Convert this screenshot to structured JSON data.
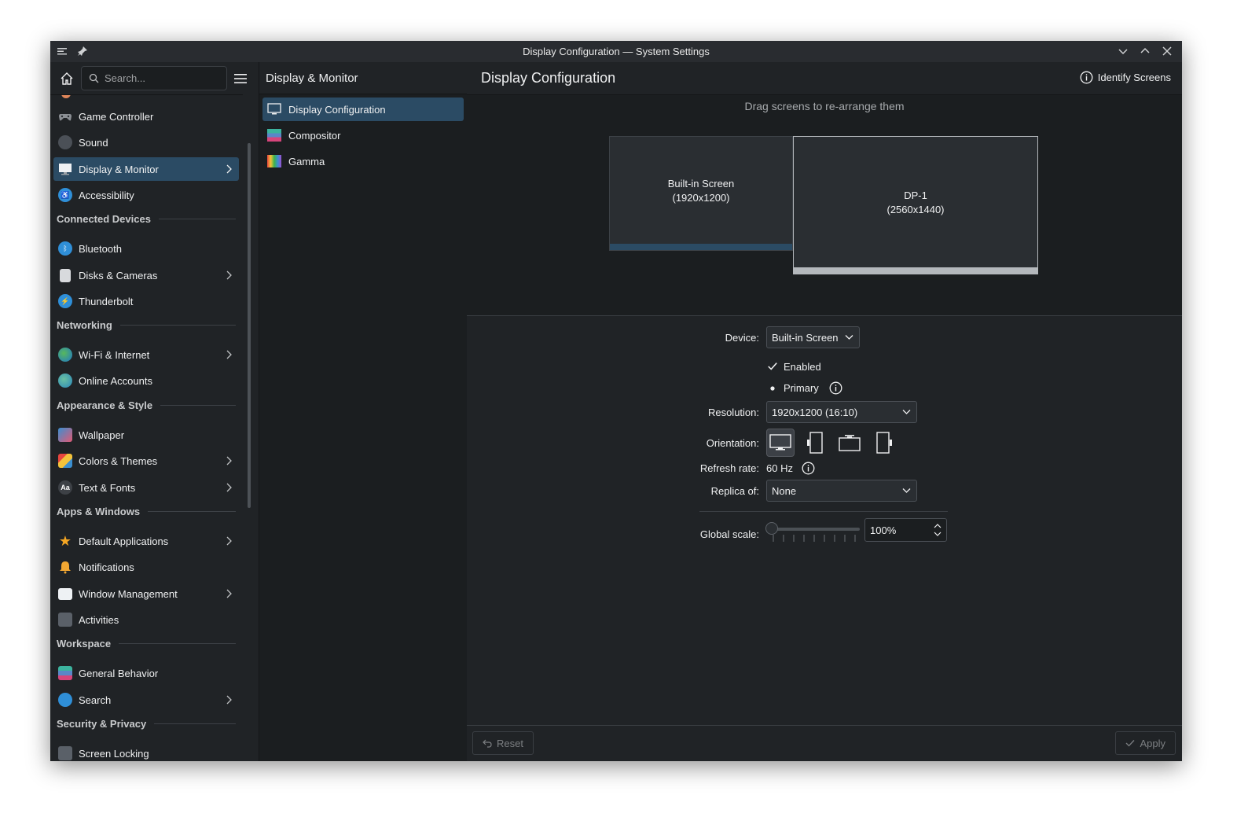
{
  "window": {
    "title": "Display Configuration — System Settings"
  },
  "search": {
    "placeholder": "Search..."
  },
  "sidebar": {
    "items": [
      {
        "label": "Game Controller",
        "icon": "gamepad-icon"
      },
      {
        "label": "Sound",
        "icon": "speaker-icon"
      },
      {
        "label": "Display & Monitor",
        "icon": "monitor-icon",
        "active": true,
        "chevron": true
      },
      {
        "label": "Accessibility",
        "icon": "accessibility-icon"
      }
    ],
    "sections": [
      {
        "title": "Connected Devices",
        "items": [
          {
            "label": "Bluetooth",
            "icon": "bluetooth-icon"
          },
          {
            "label": "Disks & Cameras",
            "icon": "disk-icon",
            "chevron": true
          },
          {
            "label": "Thunderbolt",
            "icon": "thunderbolt-icon"
          }
        ]
      },
      {
        "title": "Networking",
        "items": [
          {
            "label": "Wi-Fi & Internet",
            "icon": "globe-icon",
            "chevron": true
          },
          {
            "label": "Online Accounts",
            "icon": "online-accounts-icon"
          }
        ]
      },
      {
        "title": "Appearance & Style",
        "items": [
          {
            "label": "Wallpaper",
            "icon": "wallpaper-icon"
          },
          {
            "label": "Colors & Themes",
            "icon": "colors-icon",
            "chevron": true
          },
          {
            "label": "Text & Fonts",
            "icon": "fonts-icon",
            "chevron": true
          }
        ]
      },
      {
        "title": "Apps & Windows",
        "items": [
          {
            "label": "Default Applications",
            "icon": "star-icon",
            "chevron": true
          },
          {
            "label": "Notifications",
            "icon": "bell-icon"
          },
          {
            "label": "Window Management",
            "icon": "window-icon",
            "chevron": true
          },
          {
            "label": "Activities",
            "icon": "activities-icon"
          }
        ]
      },
      {
        "title": "Workspace",
        "items": [
          {
            "label": "General Behavior",
            "icon": "general-behavior-icon"
          },
          {
            "label": "Search",
            "icon": "search-icon",
            "chevron": true
          }
        ]
      },
      {
        "title": "Security & Privacy",
        "items": [
          {
            "label": "Screen Locking",
            "icon": "lock-icon"
          }
        ]
      }
    ]
  },
  "subpanel": {
    "title": "Display & Monitor",
    "items": [
      {
        "label": "Display Configuration",
        "active": true,
        "icon": "display-config-icon"
      },
      {
        "label": "Compositor",
        "icon": "compositor-icon"
      },
      {
        "label": "Gamma",
        "icon": "gamma-icon"
      }
    ]
  },
  "main": {
    "title": "Display Configuration",
    "identify_label": "Identify Screens",
    "hint": "Drag screens to re-arrange them",
    "screens": [
      {
        "name": "Built-in Screen",
        "res": "(1920x1200)",
        "bar_color": "#2b4b64"
      },
      {
        "name": "DP-1",
        "res": "(2560x1440)",
        "bar_color": "#b4b8bc"
      }
    ],
    "form": {
      "device_label": "Device:",
      "device_value": "Built-in Screen",
      "enabled_label": "Enabled",
      "primary_label": "Primary",
      "resolution_label": "Resolution:",
      "resolution_value": "1920x1200 (16:10)",
      "orientation_label": "Orientation:",
      "refresh_label": "Refresh rate:",
      "refresh_value": "60 Hz",
      "replica_label": "Replica of:",
      "replica_value": "None",
      "scale_label": "Global scale:",
      "scale_value": "100%"
    },
    "footer": {
      "reset_label": "Reset",
      "apply_label": "Apply"
    }
  },
  "colors": {
    "accent": "#3daee9",
    "selection": "#2b4b64",
    "window_bg": "#202326"
  }
}
